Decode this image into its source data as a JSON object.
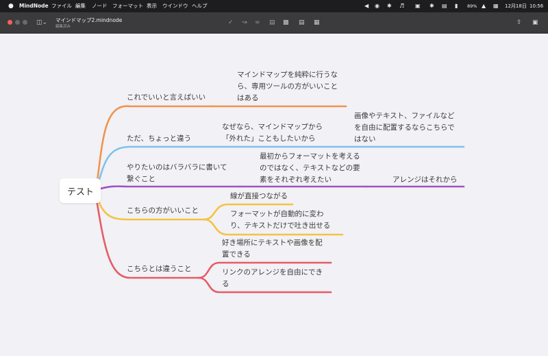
{
  "menubar": {
    "apple": "",
    "app_name": "MindNode",
    "items": [
      "ファイル",
      "編集",
      "ノード",
      "フォーマット",
      "表示",
      "ウインドウ",
      "ヘルプ"
    ],
    "status": {
      "battery": "89%",
      "date": "12月18日",
      "time": "10:56",
      "icons": [
        "sidebar-toggle-icon",
        "record-icon",
        "tool-icon",
        "volume-icon",
        "display-icon",
        "bluetooth-icon",
        "cast-icon",
        "battery-icon",
        "wifi-icon",
        "control-center-icon"
      ]
    }
  },
  "window": {
    "document_title": "マインドマップ2.mindnode",
    "document_status": "編集済み",
    "toolbar_icons": [
      "sidebar-icon",
      "check-icon",
      "connect-icon",
      "link-icon",
      "note-icon",
      "image-icon",
      "task-icon",
      "format-icon",
      "share-icon",
      "inspector-icon"
    ]
  },
  "colors": {
    "orange": "#f0934e",
    "blue": "#7cc2ee",
    "purple": "#a052c0",
    "yellow": "#f5c342",
    "red": "#e45c66",
    "canvas": "#f2f1f5"
  },
  "mindmap": {
    "root": "テスト",
    "branches": [
      {
        "label": "これでいいと言えばいい",
        "color": "#f0934e",
        "children": [
          {
            "lines": [
              "マインドマップを純粋に行うな",
              "ら、専用ツールの方がいいこと",
              "はある"
            ]
          }
        ]
      },
      {
        "label": "ただ、ちょっと違う",
        "color": "#7cc2ee",
        "children": [
          {
            "lines": [
              "なぜなら、マインドマップから",
              "「外れた」こともしたいから"
            ],
            "children": [
              {
                "lines": [
                  "画像やテキスト、ファイルなど",
                  "を自由に配置するならこちらで",
                  "はない"
                ]
              }
            ]
          }
        ]
      },
      {
        "label_lines": [
          "やりたいのはバラバラに書いて",
          "繋ぐこと"
        ],
        "color": "#a052c0",
        "children": [
          {
            "lines": [
              "最初からフォーマットを考える",
              "のではなく、テキストなどの要",
              "素をそれぞれ考えたい"
            ],
            "children": [
              {
                "lines": [
                  "アレンジはそれから"
                ]
              }
            ]
          }
        ]
      },
      {
        "label": "こちらの方がいいこと",
        "color": "#f5c342",
        "children": [
          {
            "lines": [
              "線が直接つながる"
            ]
          },
          {
            "lines": [
              "フォーマットが自動的に変わ",
              "り、テキストだけで吐き出せる"
            ]
          }
        ]
      },
      {
        "label": "こちらとは違うこと",
        "color": "#e45c66",
        "children": [
          {
            "lines": [
              "好き場所にテキストや画像を配",
              "置できる"
            ]
          },
          {
            "lines": [
              "リンクのアレンジを自由にでき",
              "る"
            ]
          }
        ]
      }
    ]
  }
}
